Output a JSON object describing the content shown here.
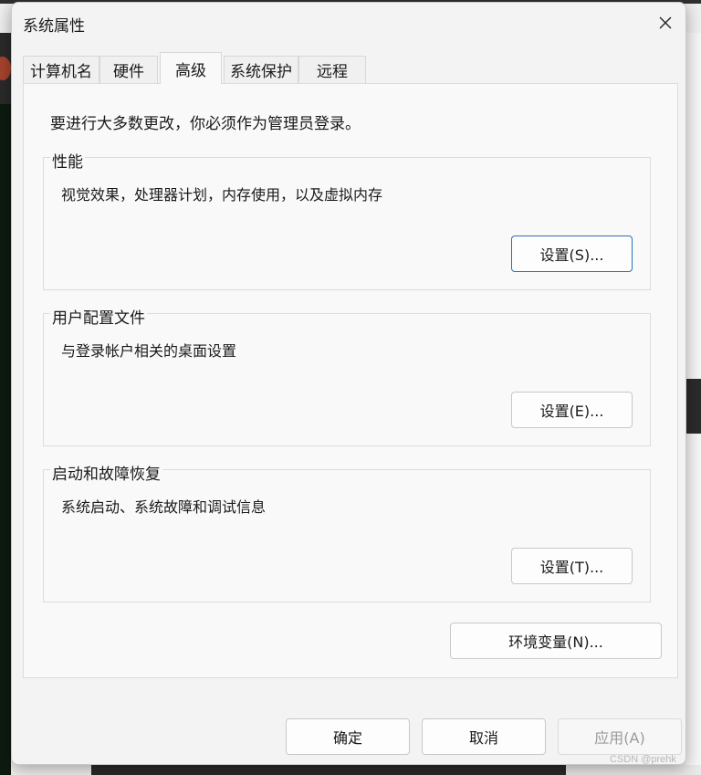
{
  "window": {
    "title": "系统属性"
  },
  "tabs": [
    {
      "label": "计算机名"
    },
    {
      "label": "硬件"
    },
    {
      "label": "高级"
    },
    {
      "label": "系统保护"
    },
    {
      "label": "远程"
    }
  ],
  "advanced": {
    "intro": "要进行大多数更改，你必须作为管理员登录。",
    "performance": {
      "title": "性能",
      "description": "视觉效果，处理器计划，内存使用，以及虚拟内存",
      "button": "设置(S)..."
    },
    "user_profiles": {
      "title": "用户配置文件",
      "description": "与登录帐户相关的桌面设置",
      "button": "设置(E)..."
    },
    "startup_recovery": {
      "title": "启动和故障恢复",
      "description": "系统启动、系统故障和调试信息",
      "button": "设置(T)..."
    },
    "env_button": "环境变量(N)..."
  },
  "footer": {
    "ok": "确定",
    "cancel": "取消",
    "apply": "应用(A)"
  },
  "watermark": "CSDN @prehk",
  "icons": {
    "close": "close-icon"
  },
  "colors": {
    "focus_border": "#2d6fb3",
    "disabled_text": "#9a9a9a"
  }
}
